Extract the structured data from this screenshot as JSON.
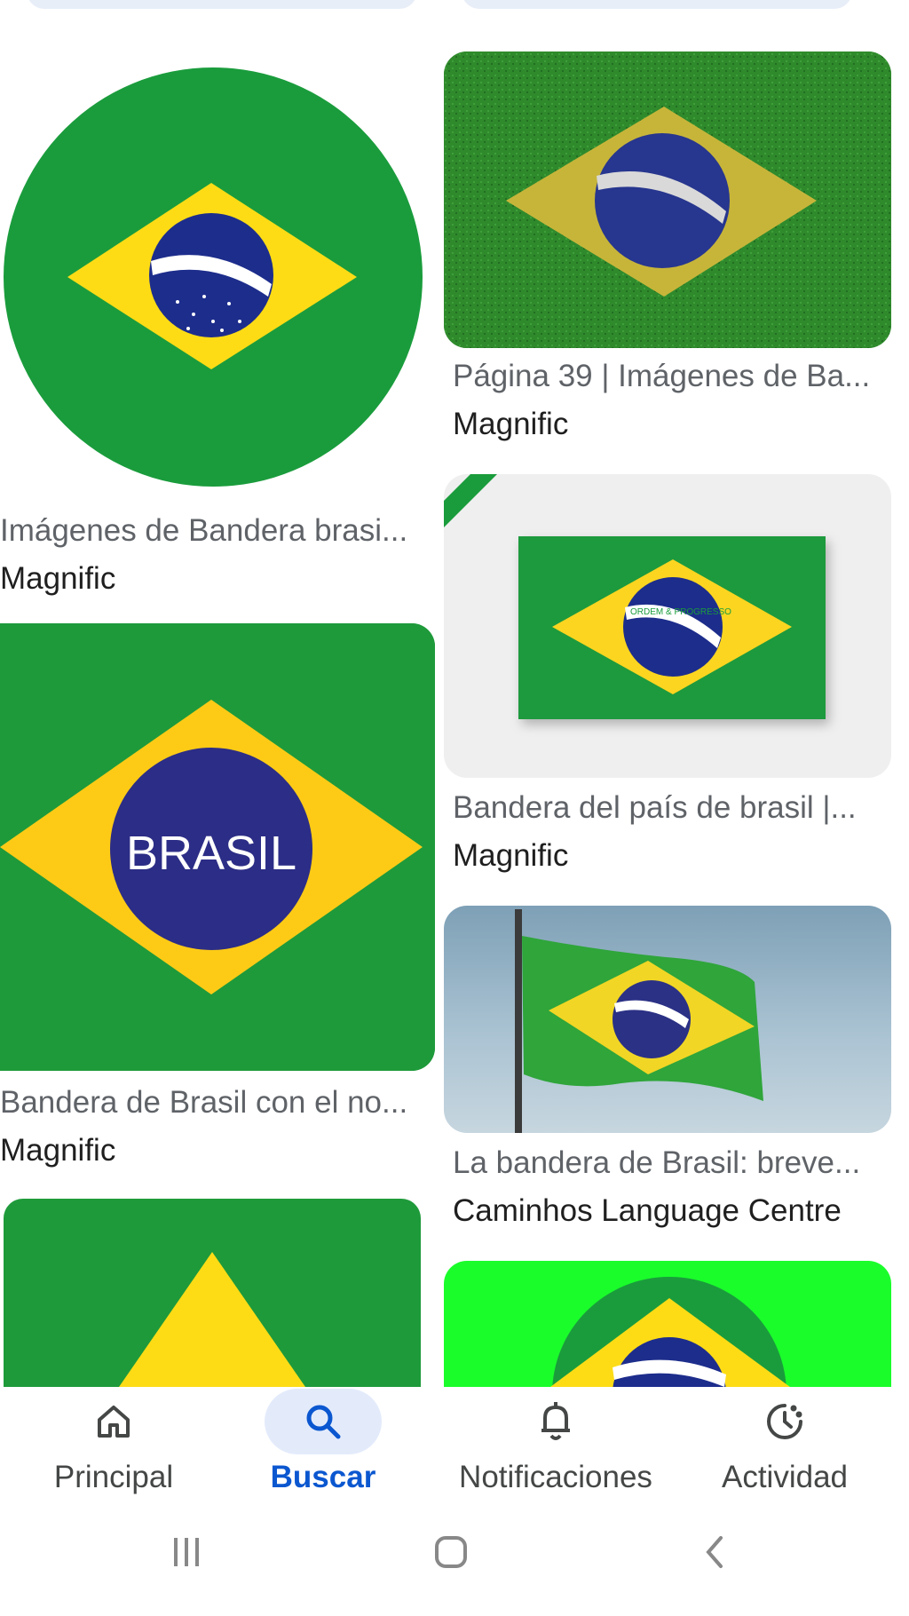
{
  "results": [
    {
      "title": "Imágenes de Bandera brasi...",
      "source": "Magnific"
    },
    {
      "title": "Página 39 | Imágenes de Ba...",
      "source": "Magnific"
    },
    {
      "title": "Bandera del país de brasil |...",
      "source": "Magnific"
    },
    {
      "title": "Bandera de Brasil con el no...",
      "source": "Magnific",
      "image_text": "BRASIL"
    },
    {
      "title": "La bandera de Brasil: breve...",
      "source": "Caminhos Language Centre"
    }
  ],
  "flag_motto": "ORDEM E PROGRESSO",
  "flag_motto_alt": "ORDEM & PROGRESSO",
  "nav": [
    {
      "label": "Principal",
      "icon": "home-icon"
    },
    {
      "label": "Buscar",
      "icon": "search-icon",
      "active": true
    },
    {
      "label": "Notificaciones",
      "icon": "bell-icon"
    },
    {
      "label": "Actividad",
      "icon": "activity-icon"
    }
  ],
  "system_nav": [
    "recent-apps-icon",
    "home-circle-icon",
    "back-icon"
  ],
  "colors": {
    "flag_green": "#1a9c3c",
    "flag_yellow": "#fddc16",
    "flag_blue": "#1d2d8c",
    "active_blue": "#0b57d0",
    "active_pill": "#e3ebfb"
  }
}
